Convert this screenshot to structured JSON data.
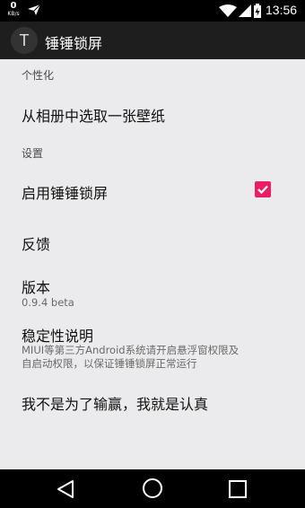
{
  "status_bar": {
    "net_speed_value": "0",
    "net_speed_unit": "KB/s",
    "time": "13:56",
    "icons": [
      "send-icon",
      "wifi-icon",
      "signal-icon",
      "battery-icon"
    ]
  },
  "app_bar": {
    "icon_letter": "T",
    "title": "锤锤锁屏"
  },
  "sections": {
    "personalize_header": "个性化",
    "settings_header": "设置"
  },
  "prefs": {
    "wallpaper": "从相册中选取一张壁纸",
    "enable_lock": "启用锤锤锁屏",
    "enable_lock_checked": true,
    "feedback": "反馈",
    "version_title": "版本",
    "version_value": "0.9.4 beta",
    "stability_title": "稳定性说明",
    "stability_line1": "MIUI等第三方Android系统请开启悬浮窗权限及",
    "stability_line2": "自启动权限，以保证锤锤锁屏正常运行",
    "slogan": "我不是为了输赢，我就是认真"
  },
  "colors": {
    "accent": "#e91e63",
    "background": "#ebebed",
    "app_bar": "#1e1e1e"
  },
  "nav_bar": {
    "icons": [
      "back-icon",
      "home-icon",
      "recents-icon"
    ]
  }
}
